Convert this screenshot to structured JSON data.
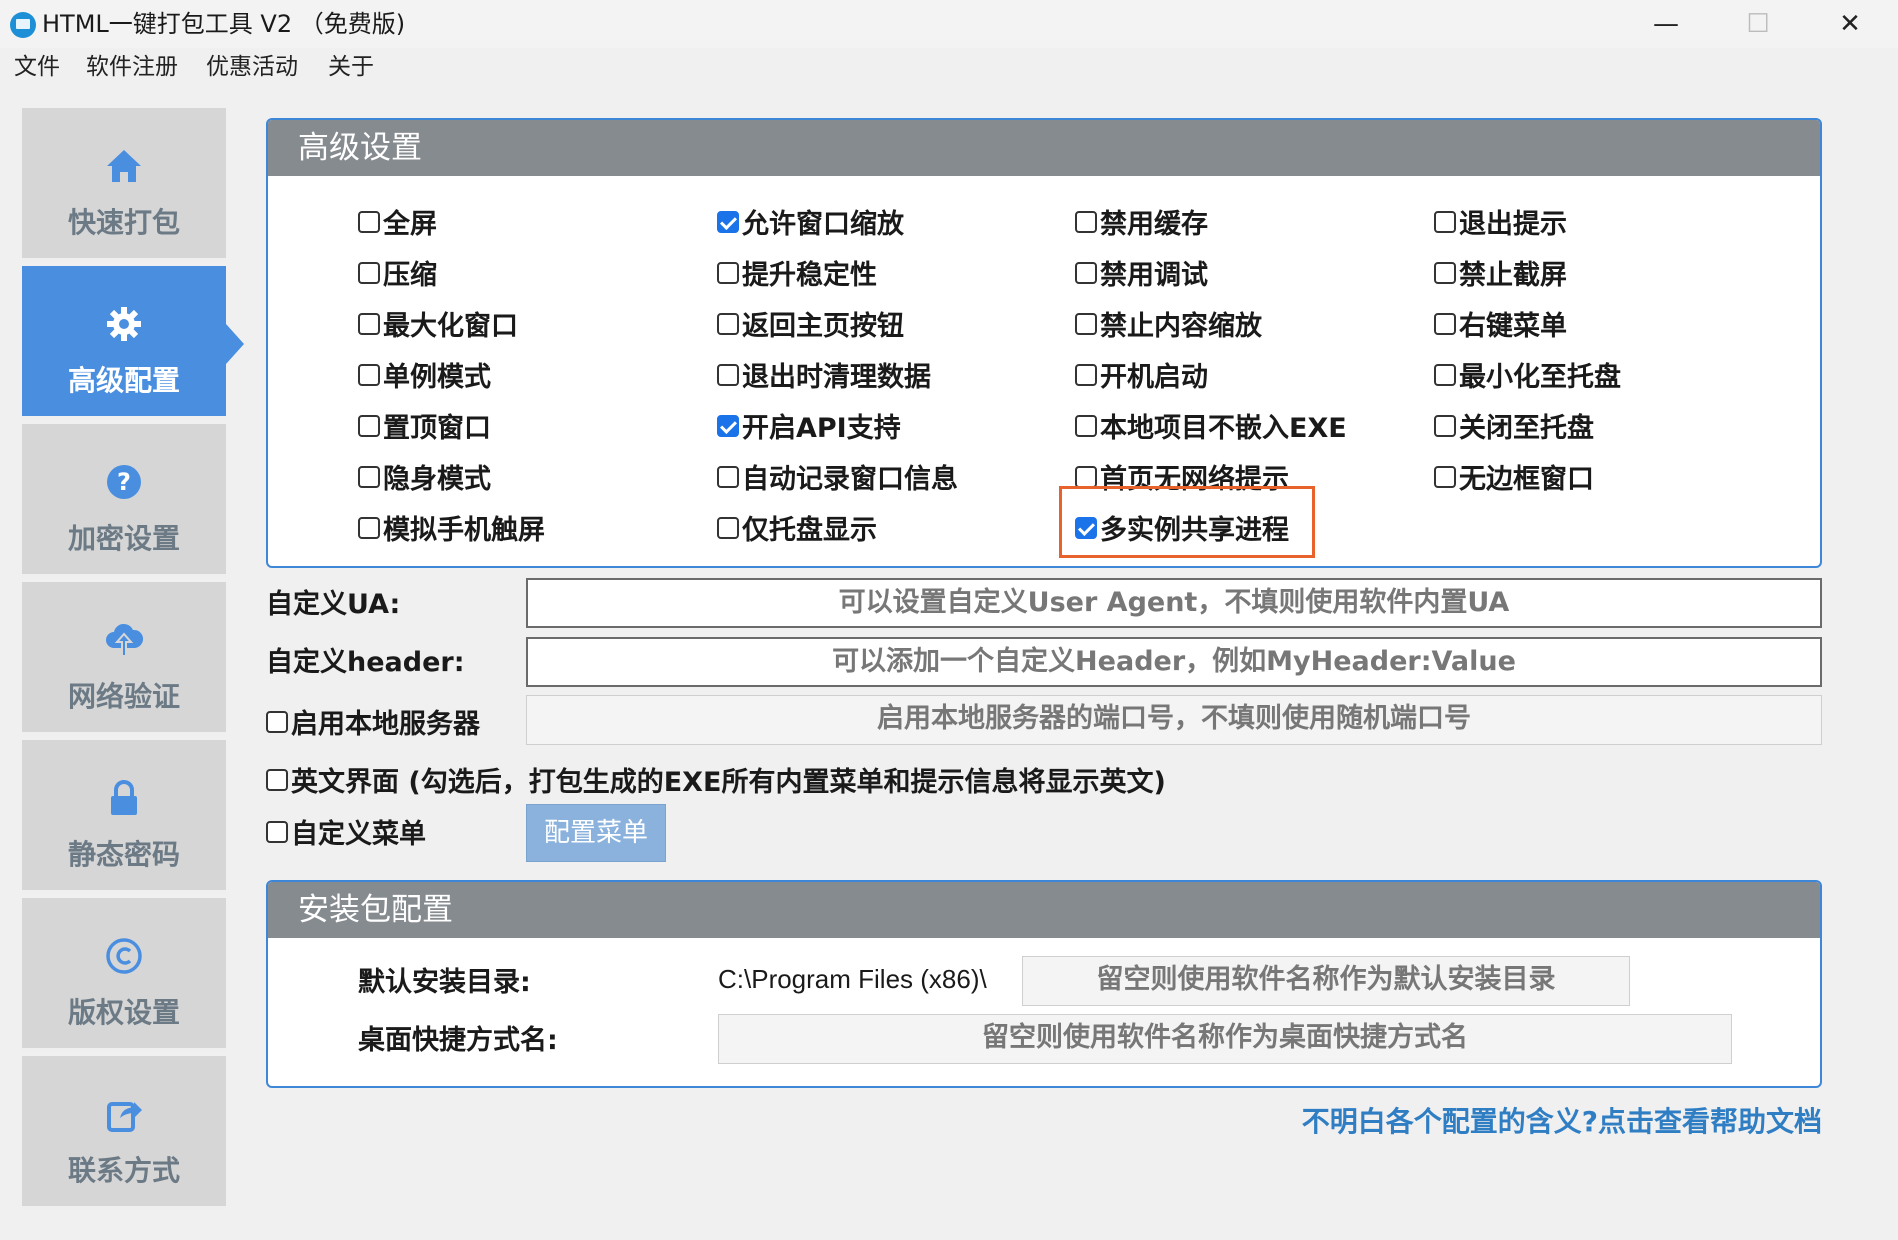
{
  "window": {
    "title": "HTML一键打包工具 V2 （免费版)",
    "min": "—",
    "max": "☐",
    "close": "✕"
  },
  "menu": [
    "文件",
    "软件注册",
    "优惠活动",
    "关于"
  ],
  "sidebar": {
    "items": [
      {
        "label": "快速打包",
        "icon": "home-icon"
      },
      {
        "label": "高级配置",
        "icon": "gear-icon",
        "active": true
      },
      {
        "label": "加密设置",
        "icon": "question-icon"
      },
      {
        "label": "网络验证",
        "icon": "cloud-upload-icon"
      },
      {
        "label": "静态密码",
        "icon": "lock-icon"
      },
      {
        "label": "版权设置",
        "icon": "copyright-icon"
      },
      {
        "label": "联系方式",
        "icon": "share-icon"
      }
    ]
  },
  "advanced": {
    "title": "高级设置",
    "columns": [
      [
        {
          "label": "全屏",
          "checked": false
        },
        {
          "label": "压缩",
          "checked": false
        },
        {
          "label": "最大化窗口",
          "checked": false
        },
        {
          "label": "单例模式",
          "checked": false
        },
        {
          "label": "置顶窗口",
          "checked": false
        },
        {
          "label": "隐身模式",
          "checked": false
        },
        {
          "label": "模拟手机触屏",
          "checked": false
        }
      ],
      [
        {
          "label": "允许窗口缩放",
          "checked": true
        },
        {
          "label": "提升稳定性",
          "checked": false
        },
        {
          "label": "返回主页按钮",
          "checked": false
        },
        {
          "label": "退出时清理数据",
          "checked": false
        },
        {
          "label": "开启API支持",
          "checked": true
        },
        {
          "label": "自动记录窗口信息",
          "checked": false
        },
        {
          "label": "仅托盘显示",
          "checked": false
        }
      ],
      [
        {
          "label": "禁用缓存",
          "checked": false
        },
        {
          "label": "禁用调试",
          "checked": false
        },
        {
          "label": "禁止内容缩放",
          "checked": false
        },
        {
          "label": "开机启动",
          "checked": false
        },
        {
          "label": "本地项目不嵌入EXE",
          "checked": false
        },
        {
          "label": "首页无网络提示",
          "checked": false
        },
        {
          "label": "多实例共享进程",
          "checked": true
        }
      ],
      [
        {
          "label": "退出提示",
          "checked": false
        },
        {
          "label": "禁止截屏",
          "checked": false
        },
        {
          "label": "右键菜单",
          "checked": false
        },
        {
          "label": "最小化至托盘",
          "checked": false
        },
        {
          "label": "关闭至托盘",
          "checked": false
        },
        {
          "label": "无边框窗口",
          "checked": false
        }
      ]
    ]
  },
  "custom": {
    "ua_label": "自定义UA:",
    "ua_placeholder": "可以设置自定义User Agent，不填则使用软件内置UA",
    "header_label": "自定义header:",
    "header_placeholder": "可以添加一个自定义Header，例如MyHeader:Value",
    "local_server_label": "启用本地服务器",
    "local_server_placeholder": "启用本地服务器的端口号，不填则使用随机端口号",
    "english_label": "英文界面 (勾选后，打包生成的EXE所有内置菜单和提示信息将显示英文)",
    "custom_menu_label": "自定义菜单",
    "config_menu_button": "配置菜单"
  },
  "installer": {
    "title": "安装包配置",
    "dir_label": "默认安装目录:",
    "dir_prefix": "C:\\Program Files (x86)\\",
    "dir_placeholder": "留空则使用软件名称作为默认安装目录",
    "shortcut_label": "桌面快捷方式名:",
    "shortcut_placeholder": "留空则使用软件名称作为桌面快捷方式名"
  },
  "help_link": "不明白各个配置的含义?点击查看帮助文档",
  "colors": {
    "accent": "#4a8ee0",
    "header": "#868b90",
    "highlight": "#e8622c",
    "link": "#2f7ec4"
  }
}
